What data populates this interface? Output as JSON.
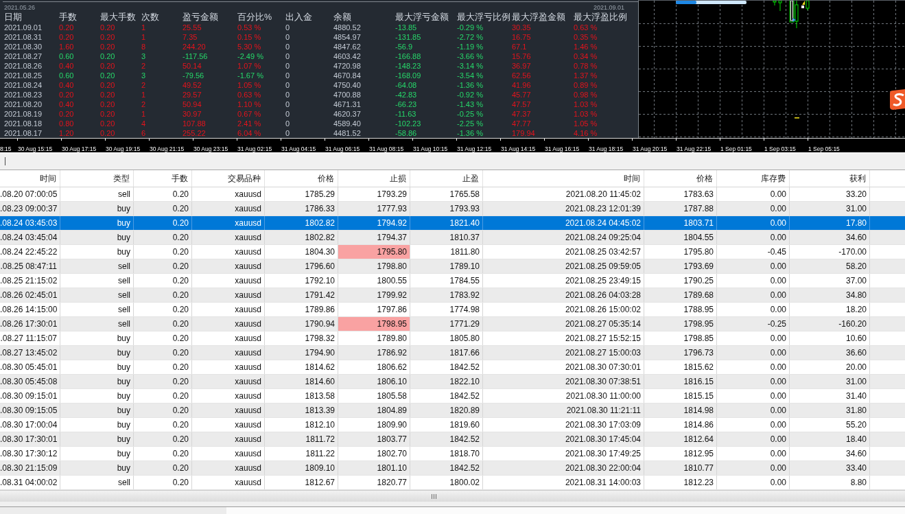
{
  "stats": {
    "start_date": "2021.05.26",
    "end_date": "2021.09.01",
    "columns": [
      "日期",
      "手数",
      "最大手数",
      "次数",
      "盈亏金额",
      "百分比%",
      "出入金",
      "余额",
      "最大浮亏金额",
      "最大浮亏比例",
      "最大浮盈金额",
      "最大浮盈比例"
    ],
    "rows": [
      {
        "loss": false,
        "cells": [
          "2021.09.01",
          "0.20",
          "0.20",
          "1",
          "25.55",
          "0.53 %",
          "0",
          "4880.52",
          "-13.85",
          "-0.29 %",
          "30.35",
          "0.63 %"
        ]
      },
      {
        "loss": false,
        "cells": [
          "2021.08.31",
          "0.20",
          "0.20",
          "1",
          "7.35",
          "0.15 %",
          "0",
          "4854.97",
          "-131.85",
          "-2.72 %",
          "16.75",
          "0.35 %"
        ]
      },
      {
        "loss": false,
        "cells": [
          "2021.08.30",
          "1.60",
          "0.20",
          "8",
          "244.20",
          "5.30 %",
          "0",
          "4847.62",
          "-56.9",
          "-1.19 %",
          "67.1",
          "1.46 %"
        ]
      },
      {
        "loss": true,
        "cells": [
          "2021.08.27",
          "0.60",
          "0.20",
          "3",
          "-117.56",
          "-2.49 %",
          "0",
          "4603.42",
          "-166.88",
          "-3.66 %",
          "15.76",
          "0.34 %"
        ]
      },
      {
        "loss": false,
        "cells": [
          "2021.08.26",
          "0.40",
          "0.20",
          "2",
          "50.14",
          "1.07 %",
          "0",
          "4720.98",
          "-148.23",
          "-3.14 %",
          "36.97",
          "0.78 %"
        ]
      },
      {
        "loss": true,
        "cells": [
          "2021.08.25",
          "0.60",
          "0.20",
          "3",
          "-79.56",
          "-1.67 %",
          "0",
          "4670.84",
          "-168.09",
          "-3.54 %",
          "62.56",
          "1.37 %"
        ]
      },
      {
        "loss": false,
        "cells": [
          "2021.08.24",
          "0.40",
          "0.20",
          "2",
          "49.52",
          "1.05 %",
          "0",
          "4750.40",
          "-64.08",
          "-1.36 %",
          "41.96",
          "0.89 %"
        ]
      },
      {
        "loss": false,
        "cells": [
          "2021.08.23",
          "0.20",
          "0.20",
          "1",
          "29.57",
          "0.63 %",
          "0",
          "4700.88",
          "-42.83",
          "-0.92 %",
          "45.77",
          "0.98 %"
        ]
      },
      {
        "loss": false,
        "cells": [
          "2021.08.20",
          "0.40",
          "0.20",
          "2",
          "50.94",
          "1.10 %",
          "0",
          "4671.31",
          "-66.23",
          "-1.43 %",
          "47.57",
          "1.03 %"
        ]
      },
      {
        "loss": false,
        "cells": [
          "2021.08.19",
          "0.20",
          "0.20",
          "1",
          "30.97",
          "0.67 %",
          "0",
          "4620.37",
          "-11.63",
          "-0.25 %",
          "47.37",
          "1.03 %"
        ]
      },
      {
        "loss": false,
        "cells": [
          "2021.08.18",
          "0.80",
          "0.20",
          "4",
          "107.88",
          "2.41 %",
          "0",
          "4589.40",
          "-102.23",
          "-2.25 %",
          "47.77",
          "1.05 %"
        ]
      },
      {
        "loss": false,
        "cells": [
          "2021.08.17",
          "1.20",
          "0.20",
          "6",
          "255.22",
          "6.04 %",
          "0",
          "4481.52",
          "-58.86",
          "-1.36 %",
          "179.94",
          "4.16 %"
        ]
      }
    ]
  },
  "time_axis": {
    "labels": [
      "8:15",
      "30 Aug 15:15",
      "30 Aug 17:15",
      "30 Aug 19:15",
      "30 Aug 21:15",
      "30 Aug 23:15",
      "31 Aug 02:15",
      "31 Aug 04:15",
      "31 Aug 06:15",
      "31 Aug 08:15",
      "31 Aug 10:15",
      "31 Aug 12:15",
      "31 Aug 14:15",
      "31 Aug 16:15",
      "31 Aug 18:15",
      "31 Aug 20:15",
      "31 Aug 22:15",
      "1 Sep 01:15",
      "1 Sep 03:15",
      "1 Sep 05:15"
    ]
  },
  "orders": {
    "columns": [
      "时间",
      "类型",
      "手数",
      "交易品种",
      "价格",
      "止损",
      "止盈",
      "时间",
      "价格",
      "库存费",
      "获利"
    ],
    "rows": [
      {
        "selected": false,
        "stop_loss_highlighted": false,
        "cells": [
          ".08.20 07:00:05",
          "sell",
          "0.20",
          "xauusd",
          "1785.29",
          "1793.29",
          "1765.58",
          "2021.08.20 11:45:02",
          "1783.63",
          "0.00",
          "33.20"
        ]
      },
      {
        "selected": false,
        "stop_loss_highlighted": false,
        "cells": [
          ".08.23 09:00:37",
          "buy",
          "0.20",
          "xauusd",
          "1786.33",
          "1777.93",
          "1793.93",
          "2021.08.23 12:01:39",
          "1787.88",
          "0.00",
          "31.00"
        ]
      },
      {
        "selected": true,
        "stop_loss_highlighted": false,
        "cells": [
          ".08.24 03:45:03",
          "buy",
          "0.20",
          "xauusd",
          "1802.82",
          "1794.92",
          "1821.40",
          "2021.08.24 04:45:02",
          "1803.71",
          "0.00",
          "17.80"
        ]
      },
      {
        "selected": false,
        "stop_loss_highlighted": false,
        "cells": [
          ".08.24 03:45:04",
          "buy",
          "0.20",
          "xauusd",
          "1802.82",
          "1794.37",
          "1810.37",
          "2021.08.24 09:25:04",
          "1804.55",
          "0.00",
          "34.60"
        ]
      },
      {
        "selected": false,
        "stop_loss_highlighted": true,
        "cells": [
          ".08.24 22:45:22",
          "buy",
          "0.20",
          "xauusd",
          "1804.30",
          "1795.80",
          "1811.80",
          "2021.08.25 03:42:57",
          "1795.80",
          "-0.45",
          "-170.00"
        ]
      },
      {
        "selected": false,
        "stop_loss_highlighted": false,
        "cells": [
          ".08.25 08:47:11",
          "sell",
          "0.20",
          "xauusd",
          "1796.60",
          "1798.80",
          "1789.10",
          "2021.08.25 09:59:05",
          "1793.69",
          "0.00",
          "58.20"
        ]
      },
      {
        "selected": false,
        "stop_loss_highlighted": false,
        "cells": [
          ".08.25 21:15:02",
          "sell",
          "0.20",
          "xauusd",
          "1792.10",
          "1800.55",
          "1784.55",
          "2021.08.25 23:49:15",
          "1790.25",
          "0.00",
          "37.00"
        ]
      },
      {
        "selected": false,
        "stop_loss_highlighted": false,
        "cells": [
          ".08.26 02:45:01",
          "sell",
          "0.20",
          "xauusd",
          "1791.42",
          "1799.92",
          "1783.92",
          "2021.08.26 04:03:28",
          "1789.68",
          "0.00",
          "34.80"
        ]
      },
      {
        "selected": false,
        "stop_loss_highlighted": false,
        "cells": [
          ".08.26 14:15:00",
          "sell",
          "0.20",
          "xauusd",
          "1789.86",
          "1797.86",
          "1774.98",
          "2021.08.26 15:00:02",
          "1788.95",
          "0.00",
          "18.20"
        ]
      },
      {
        "selected": false,
        "stop_loss_highlighted": true,
        "cells": [
          ".08.26 17:30:01",
          "sell",
          "0.20",
          "xauusd",
          "1790.94",
          "1798.95",
          "1771.29",
          "2021.08.27 05:35:14",
          "1798.95",
          "-0.25",
          "-160.20"
        ]
      },
      {
        "selected": false,
        "stop_loss_highlighted": false,
        "cells": [
          ".08.27 11:15:07",
          "buy",
          "0.20",
          "xauusd",
          "1798.32",
          "1789.80",
          "1805.80",
          "2021.08.27 15:52:15",
          "1798.85",
          "0.00",
          "10.60"
        ]
      },
      {
        "selected": false,
        "stop_loss_highlighted": false,
        "cells": [
          ".08.27 13:45:02",
          "buy",
          "0.20",
          "xauusd",
          "1794.90",
          "1786.92",
          "1817.66",
          "2021.08.27 15:00:03",
          "1796.73",
          "0.00",
          "36.60"
        ]
      },
      {
        "selected": false,
        "stop_loss_highlighted": false,
        "cells": [
          ".08.30 05:45:01",
          "buy",
          "0.20",
          "xauusd",
          "1814.62",
          "1806.62",
          "1842.52",
          "2021.08.30 07:30:01",
          "1815.62",
          "0.00",
          "20.00"
        ]
      },
      {
        "selected": false,
        "stop_loss_highlighted": false,
        "cells": [
          ".08.30 05:45:08",
          "buy",
          "0.20",
          "xauusd",
          "1814.60",
          "1806.10",
          "1822.10",
          "2021.08.30 07:38:51",
          "1816.15",
          "0.00",
          "31.00"
        ]
      },
      {
        "selected": false,
        "stop_loss_highlighted": false,
        "cells": [
          ".08.30 09:15:01",
          "buy",
          "0.20",
          "xauusd",
          "1813.58",
          "1805.58",
          "1842.52",
          "2021.08.30 11:00:00",
          "1815.15",
          "0.00",
          "31.40"
        ]
      },
      {
        "selected": false,
        "stop_loss_highlighted": false,
        "cells": [
          ".08.30 09:15:05",
          "buy",
          "0.20",
          "xauusd",
          "1813.39",
          "1804.89",
          "1820.89",
          "2021.08.30 11:21:11",
          "1814.98",
          "0.00",
          "31.80"
        ]
      },
      {
        "selected": false,
        "stop_loss_highlighted": false,
        "cells": [
          ".08.30 17:00:04",
          "buy",
          "0.20",
          "xauusd",
          "1812.10",
          "1809.90",
          "1819.60",
          "2021.08.30 17:03:09",
          "1814.86",
          "0.00",
          "55.20"
        ]
      },
      {
        "selected": false,
        "stop_loss_highlighted": false,
        "cells": [
          ".08.30 17:30:01",
          "buy",
          "0.20",
          "xauusd",
          "1811.72",
          "1803.77",
          "1842.52",
          "2021.08.30 17:45:04",
          "1812.64",
          "0.00",
          "18.40"
        ]
      },
      {
        "selected": false,
        "stop_loss_highlighted": false,
        "cells": [
          ".08.30 17:30:12",
          "buy",
          "0.20",
          "xauusd",
          "1811.22",
          "1802.70",
          "1818.70",
          "2021.08.30 17:49:25",
          "1812.95",
          "0.00",
          "34.60"
        ]
      },
      {
        "selected": false,
        "stop_loss_highlighted": false,
        "cells": [
          ".08.30 21:15:09",
          "buy",
          "0.20",
          "xauusd",
          "1809.10",
          "1801.10",
          "1842.52",
          "2021.08.30 22:00:04",
          "1810.77",
          "0.00",
          "33.40"
        ]
      },
      {
        "selected": false,
        "stop_loss_highlighted": false,
        "cells": [
          ".08.31 04:00:02",
          "sell",
          "0.20",
          "xauusd",
          "1812.67",
          "1820.77",
          "1800.02",
          "2021.08.31 14:00:03",
          "1812.23",
          "0.00",
          "8.80"
        ]
      }
    ]
  }
}
